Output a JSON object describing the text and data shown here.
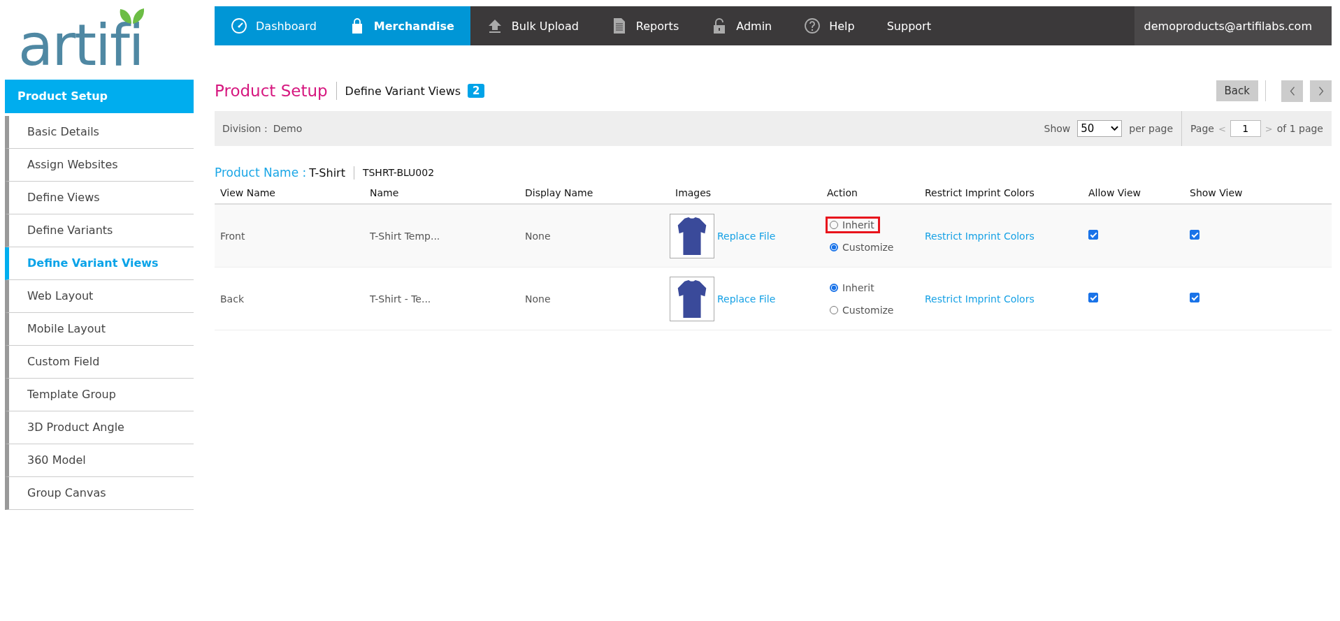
{
  "logo": {
    "text": "artifi"
  },
  "nav": {
    "items": [
      {
        "label": "Dashboard",
        "highlighted": true,
        "selected": false
      },
      {
        "label": "Merchandise",
        "highlighted": true,
        "selected": true
      },
      {
        "label": "Bulk Upload",
        "highlighted": false,
        "selected": false
      },
      {
        "label": "Reports",
        "highlighted": false,
        "selected": false
      },
      {
        "label": "Admin",
        "highlighted": false,
        "selected": false
      },
      {
        "label": "Help",
        "highlighted": false,
        "selected": false
      },
      {
        "label": "Support",
        "highlighted": false,
        "selected": false
      }
    ],
    "account": "demoproducts@artifilabs.com"
  },
  "sidebar": {
    "title": "Product Setup",
    "items": [
      {
        "label": "Basic Details",
        "selected": false
      },
      {
        "label": "Assign Websites",
        "selected": false
      },
      {
        "label": "Define Views",
        "selected": false
      },
      {
        "label": "Define Variants",
        "selected": false
      },
      {
        "label": "Define Variant Views",
        "selected": true
      },
      {
        "label": "Web Layout",
        "selected": false
      },
      {
        "label": "Mobile Layout",
        "selected": false
      },
      {
        "label": "Custom Field",
        "selected": false
      },
      {
        "label": "Template Group",
        "selected": false
      },
      {
        "label": "3D Product Angle",
        "selected": false
      },
      {
        "label": "360 Model",
        "selected": false
      },
      {
        "label": "Group Canvas",
        "selected": false
      }
    ]
  },
  "header": {
    "title": "Product Setup",
    "subtitle": "Define Variant Views",
    "count": "2",
    "back": "Back"
  },
  "filter": {
    "division_label": "Division :",
    "division": "Demo",
    "show_label": "Show",
    "per_page": "50",
    "per_page_suffix": "per page",
    "page_label": "Page",
    "prev_glyph": "<",
    "page": "1",
    "next_glyph": ">",
    "page_total": "of 1 page"
  },
  "product": {
    "label": "Product Name :",
    "name": "T-Shirt",
    "sku": "TSHRT-BLU002"
  },
  "table": {
    "columns": [
      "View Name",
      "Name",
      "Display Name",
      "Images",
      "Action",
      "Restrict Imprint Colors",
      "Allow View",
      "Show View"
    ],
    "rows": [
      {
        "view_name": "Front",
        "name": "T-Shirt Temp...",
        "display_name": "None",
        "replace": "Replace File",
        "actions": [
          {
            "label": "Inherit",
            "selected": false,
            "highlighted": true
          },
          {
            "label": "Customize",
            "selected": true,
            "highlighted": false
          }
        ],
        "restrict": "Restrict Imprint Colors",
        "allow_view": true,
        "show_view": true
      },
      {
        "view_name": "Back",
        "name": "T-Shirt - Te...",
        "display_name": "None",
        "replace": "Replace File",
        "actions": [
          {
            "label": "Inherit",
            "selected": true,
            "highlighted": false
          },
          {
            "label": "Customize",
            "selected": false,
            "highlighted": false
          }
        ],
        "restrict": "Restrict Imprint Colors",
        "allow_view": true,
        "show_view": true
      }
    ]
  }
}
